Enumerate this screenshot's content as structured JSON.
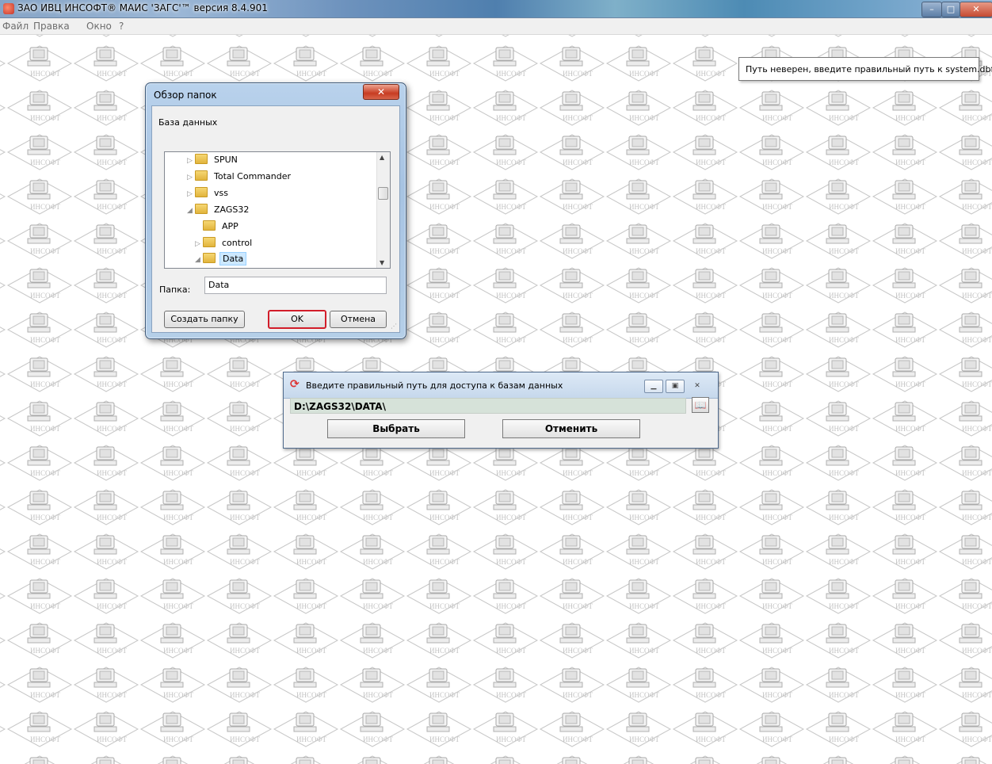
{
  "window": {
    "title": "ЗАО ИВЦ ИНСОФТ®   МАИС 'ЗАГС'™ версия 8.4.901",
    "min_glyph": "–",
    "max_glyph": "□",
    "close_glyph": "✕"
  },
  "menu": {
    "items": [
      "Файл",
      "Правка",
      "Окно",
      "?"
    ]
  },
  "tooltip": {
    "text": "Путь неверен, введите правильный путь к system.dbf"
  },
  "browse_dialog": {
    "title": "Обзор папок",
    "close_glyph": "✕",
    "description": "База данных",
    "tree": [
      {
        "label": "SPUN",
        "arrow": "▷"
      },
      {
        "label": "Total Commander",
        "arrow": "▷"
      },
      {
        "label": "vss",
        "arrow": "▷"
      },
      {
        "label": "ZAGS32",
        "arrow": "◢"
      },
      {
        "label": "APP",
        "arrow": ""
      },
      {
        "label": "control",
        "arrow": "▷"
      },
      {
        "label": "Data",
        "arrow": "◢",
        "selected": true
      }
    ],
    "folder_label": "Папка:",
    "folder_value": "Data",
    "new_folder_label": "Создать папку",
    "ok_label": "OK",
    "cancel_label": "Отмена"
  },
  "path_dialog": {
    "title": "Введите правильный путь для доступа к базам данных",
    "path_value": "D:\\ZAGS32\\DATA\\",
    "select_label": "Выбрать",
    "cancel_label": "Отменить"
  },
  "colors": {
    "ok_highlight": "#d21d2a",
    "selection": "#cce8ff",
    "path_field": "#d6e2d9"
  },
  "icons": {
    "app": "app-logo-icon",
    "folder": "folder-icon",
    "book": "book-icon",
    "refresh": "refresh-icon"
  }
}
